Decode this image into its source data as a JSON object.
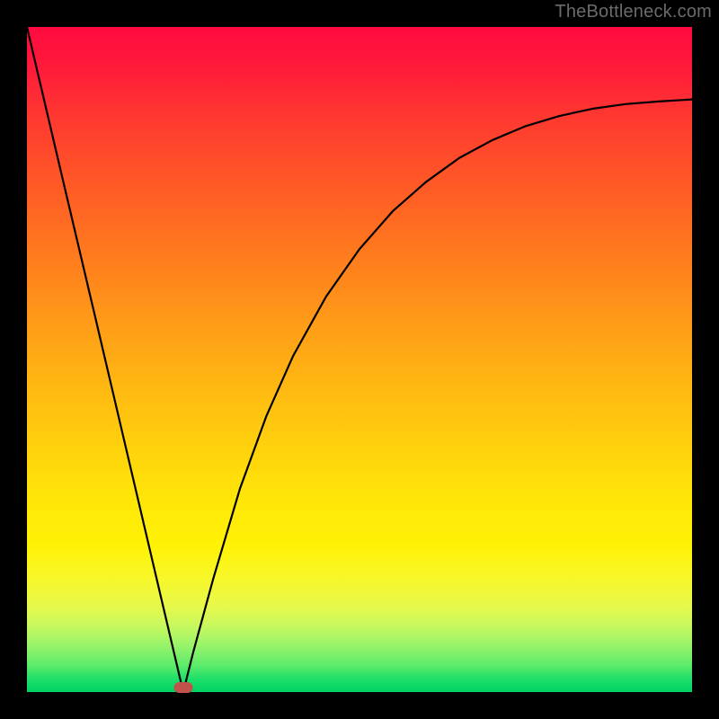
{
  "watermark": "TheBottleneck.com",
  "chart_data": {
    "type": "line",
    "title": "",
    "xlabel": "",
    "ylabel": "",
    "xlim": [
      0,
      100
    ],
    "ylim": [
      0,
      100
    ],
    "grid": false,
    "series": [
      {
        "name": "curve",
        "x": [
          0,
          5,
          10,
          15,
          20,
          23.5,
          25,
          28,
          32,
          36,
          40,
          45,
          50,
          55,
          60,
          65,
          70,
          75,
          80,
          85,
          90,
          95,
          100
        ],
        "y": [
          100,
          78.7,
          57.5,
          36.2,
          14.9,
          0.0,
          6.0,
          17.0,
          30.5,
          41.5,
          50.5,
          59.5,
          66.6,
          72.3,
          76.7,
          80.3,
          83.0,
          85.1,
          86.6,
          87.7,
          88.4,
          88.8,
          89.1
        ]
      }
    ],
    "marker": {
      "x": 23.5,
      "y": 0.7
    },
    "background_gradient": {
      "top": "#ff0a40",
      "mid": "#ffd40c",
      "bottom": "#00d264"
    }
  }
}
